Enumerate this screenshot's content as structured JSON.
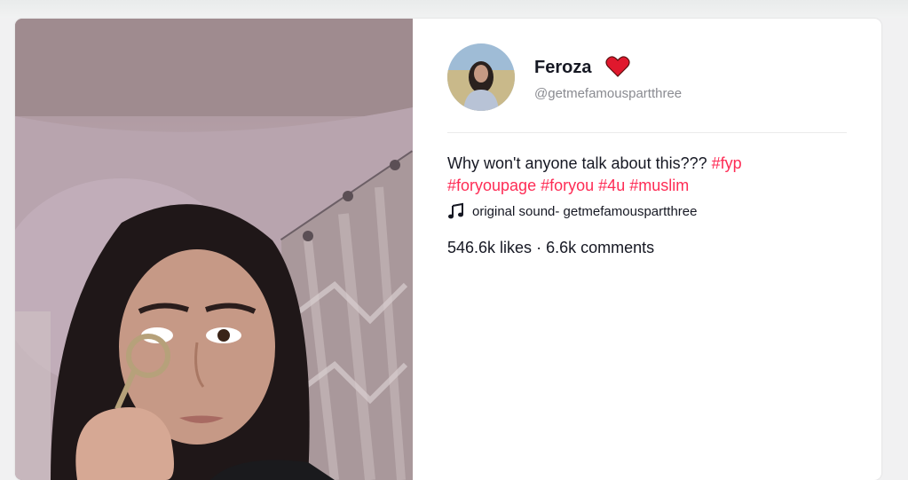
{
  "post": {
    "author": {
      "name": "Feroza",
      "handle": "@getmefamouspartthree",
      "badge_icon": "heart-icon",
      "badge_color": "#e0182d"
    },
    "caption": {
      "text": "Why won't anyone talk about this???",
      "hashtags": [
        "#fyp",
        "#foryoupage",
        "#foryou",
        "#4u",
        "#muslim"
      ]
    },
    "sound": {
      "icon": "music-note-icon",
      "label": "original sound- getmefamouspartthree"
    },
    "stats": {
      "likes": "546.6k likes",
      "separator": "·",
      "comments": "6.6k comments"
    },
    "colors": {
      "hashtag": "#fe2c55",
      "text": "#161823",
      "muted": "#8a8b91"
    }
  }
}
